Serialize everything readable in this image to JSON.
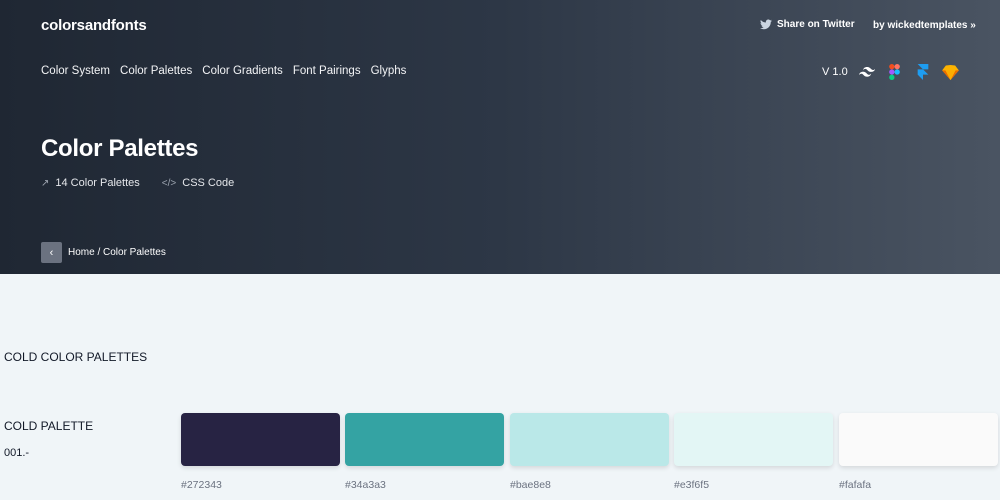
{
  "header": {
    "brand": "colorsandfonts",
    "share": "Share on Twitter",
    "byline": "by wickedtemplates »"
  },
  "nav": {
    "items": [
      "Color System",
      "Color Palettes",
      "Color Gradients",
      "Font Pairings",
      "Glyphs"
    ]
  },
  "tools": {
    "version": "V 1.0",
    "icons": [
      "tailwind-icon",
      "figma-icon",
      "framer-icon",
      "sketch-icon"
    ]
  },
  "hero": {
    "title": "Color Palettes",
    "count_label": "14 Color Palettes",
    "code_label": "CSS Code"
  },
  "breadcrumb": {
    "path": "Home / Color Palettes"
  },
  "content": {
    "section_title": "COLD COLOR PALETTES",
    "palette_title": "COLD PALETTE",
    "palette_number": "001.-",
    "swatches": [
      {
        "hex": "#272343",
        "color": "#272343"
      },
      {
        "hex": "#34a3a3",
        "color": "#34a3a3"
      },
      {
        "hex": "#bae8e8",
        "color": "#bae8e8"
      },
      {
        "hex": "#e3f6f5",
        "color": "#e3f6f5"
      },
      {
        "hex": "#fafafa",
        "color": "#fafafa"
      }
    ]
  }
}
